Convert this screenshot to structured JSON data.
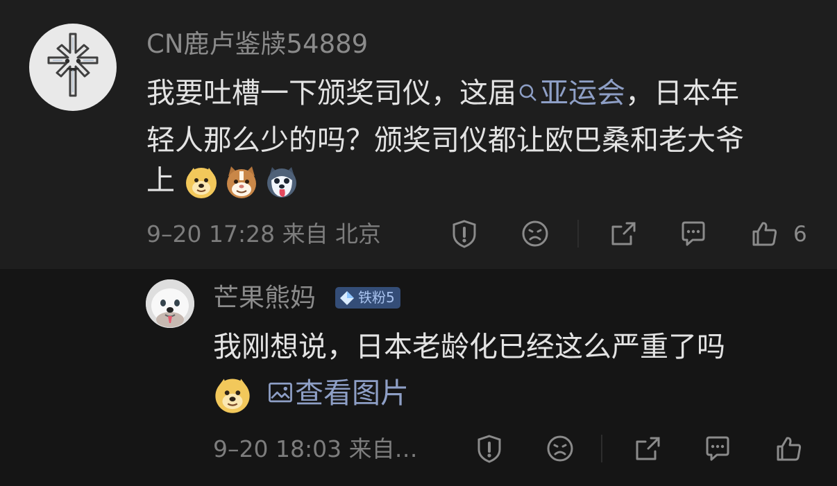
{
  "main": {
    "username": "CN鹿卢鉴牍54889",
    "line1_before": "我要吐槽一下颁奖司仪，这届",
    "topic_link": "亚运会",
    "line1_after": "，日本年",
    "line2": "轻人那么少的吗？颁奖司仪都让欧巴桑和老大爷",
    "line3": "上",
    "emojis": [
      "doge-emoji",
      "cat-emoji",
      "husky-emoji"
    ],
    "meta": "9–20 17:28  来自  北京",
    "like_count": "6"
  },
  "reply": {
    "username": "芒果熊妈",
    "badge": "铁粉5",
    "line1": "我刚想说，日本老龄化已经这么严重了吗",
    "view_image": "查看图片",
    "meta": "9–20 18:03  来自…"
  },
  "colors": {
    "background": "#151515",
    "card": "#1e1e1e",
    "text": "#e3e3e3",
    "muted": "#8b8b8b",
    "link": "#8e9fc6",
    "badge": "#344d77"
  }
}
